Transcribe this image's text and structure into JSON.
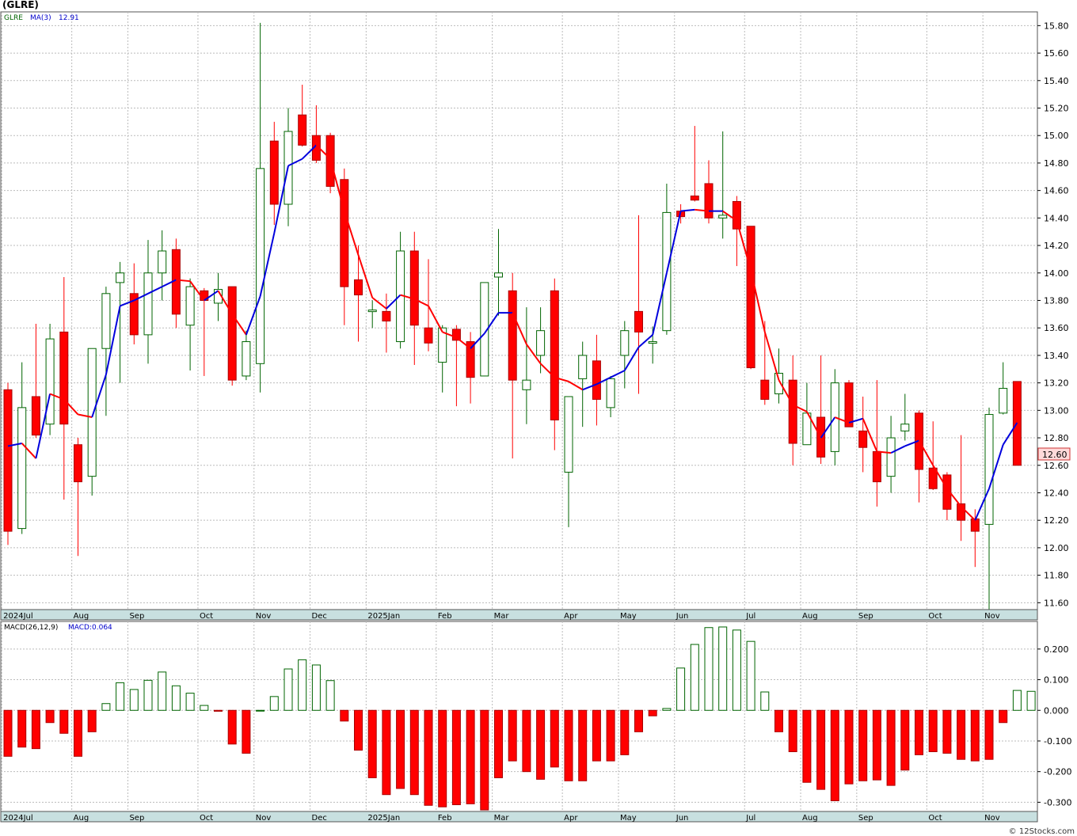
{
  "title": "(GLRE)",
  "credit": "© 12Stocks.com",
  "colors": {
    "up": "#006400",
    "down": "#ff0000",
    "ma_up": "#0000dd",
    "ma_down": "#ff0000",
    "axisbar": "#c8e0e0",
    "grid": "#bbbbbb",
    "last_tag_bg": "#ffd9d9"
  },
  "legend": {
    "symbol": "GLRE",
    "ma_label": "MA(3)",
    "ma_value": "12.91",
    "macd_label": "MACD(26,12,9)",
    "macd_value_label": "MACD:0.064"
  },
  "last_price_tag": "12.60",
  "chart_data": [
    {
      "type": "candlestick",
      "name": "GLRE weekly price",
      "ylim": [
        11.55,
        15.9
      ],
      "y_ticks": [
        "11.60",
        "11.80",
        "12.00",
        "12.20",
        "12.40",
        "12.60",
        "12.80",
        "13.00",
        "13.20",
        "13.40",
        "13.60",
        "13.80",
        "14.00",
        "14.20",
        "14.40",
        "14.60",
        "14.80",
        "15.00",
        "15.20",
        "15.40",
        "15.60",
        "15.80"
      ],
      "x_labels": [
        {
          "label": "2024Jul",
          "index": 0
        },
        {
          "label": "Aug",
          "index": 5
        },
        {
          "label": "Sep",
          "index": 9
        },
        {
          "label": "Oct",
          "index": 14
        },
        {
          "label": "Nov",
          "index": 18
        },
        {
          "label": "Dec",
          "index": 22
        },
        {
          "label": "2025Jan",
          "index": 26
        },
        {
          "label": "Feb",
          "index": 31
        },
        {
          "label": "Mar",
          "index": 35
        },
        {
          "label": "Apr",
          "index": 40
        },
        {
          "label": "May",
          "index": 44
        },
        {
          "label": "Jun",
          "index": 48
        },
        {
          "label": "Jul",
          "index": 53
        },
        {
          "label": "Aug",
          "index": 57
        },
        {
          "label": "Sep",
          "index": 61
        },
        {
          "label": "Oct",
          "index": 66
        },
        {
          "label": "Nov",
          "index": 70
        }
      ],
      "candles": [
        {
          "o": 13.15,
          "h": 13.2,
          "l": 12.02,
          "c": 12.12
        },
        {
          "o": 12.14,
          "h": 13.35,
          "l": 12.1,
          "c": 13.02
        },
        {
          "o": 13.1,
          "h": 13.63,
          "l": 12.8,
          "c": 12.82
        },
        {
          "o": 12.9,
          "h": 13.63,
          "l": 12.82,
          "c": 13.52
        },
        {
          "o": 13.57,
          "h": 13.97,
          "l": 12.35,
          "c": 12.9
        },
        {
          "o": 12.75,
          "h": 12.8,
          "l": 11.94,
          "c": 12.48
        },
        {
          "o": 12.52,
          "h": 13.45,
          "l": 12.38,
          "c": 13.45
        },
        {
          "o": 13.45,
          "h": 13.9,
          "l": 12.96,
          "c": 13.85
        },
        {
          "o": 13.93,
          "h": 14.08,
          "l": 13.2,
          "c": 14.0
        },
        {
          "o": 13.85,
          "h": 14.07,
          "l": 13.48,
          "c": 13.55
        },
        {
          "o": 13.55,
          "h": 14.24,
          "l": 13.34,
          "c": 14.0
        },
        {
          "o": 14.0,
          "h": 14.31,
          "l": 13.8,
          "c": 14.16
        },
        {
          "o": 14.17,
          "h": 14.25,
          "l": 13.6,
          "c": 13.7
        },
        {
          "o": 13.62,
          "h": 13.96,
          "l": 13.29,
          "c": 13.9
        },
        {
          "o": 13.87,
          "h": 13.89,
          "l": 13.25,
          "c": 13.8
        },
        {
          "o": 13.78,
          "h": 14.0,
          "l": 13.65,
          "c": 13.88
        },
        {
          "o": 13.9,
          "h": 13.9,
          "l": 13.18,
          "c": 13.22
        },
        {
          "o": 13.25,
          "h": 13.58,
          "l": 13.22,
          "c": 13.5
        },
        {
          "o": 13.34,
          "h": 15.82,
          "l": 13.13,
          "c": 14.76
        },
        {
          "o": 14.96,
          "h": 15.1,
          "l": 14.35,
          "c": 14.5
        },
        {
          "o": 14.5,
          "h": 15.2,
          "l": 14.34,
          "c": 15.03
        },
        {
          "o": 15.15,
          "h": 15.37,
          "l": 14.92,
          "c": 14.93
        },
        {
          "o": 15.0,
          "h": 15.22,
          "l": 14.8,
          "c": 14.82
        },
        {
          "o": 15.0,
          "h": 15.02,
          "l": 14.58,
          "c": 14.63
        },
        {
          "o": 14.68,
          "h": 14.76,
          "l": 13.62,
          "c": 13.9
        },
        {
          "o": 13.95,
          "h": 14.2,
          "l": 13.5,
          "c": 13.84
        },
        {
          "o": 13.73,
          "h": 13.8,
          "l": 13.6,
          "c": 13.73
        },
        {
          "o": 13.72,
          "h": 13.85,
          "l": 13.42,
          "c": 13.65
        },
        {
          "o": 13.5,
          "h": 14.3,
          "l": 13.45,
          "c": 14.16
        },
        {
          "o": 14.16,
          "h": 14.3,
          "l": 13.33,
          "c": 13.62
        },
        {
          "o": 13.6,
          "h": 14.1,
          "l": 13.43,
          "c": 13.49
        },
        {
          "o": 13.35,
          "h": 13.62,
          "l": 13.13,
          "c": 13.6
        },
        {
          "o": 13.59,
          "h": 13.62,
          "l": 13.03,
          "c": 13.51
        },
        {
          "o": 13.5,
          "h": 13.57,
          "l": 13.05,
          "c": 13.24
        },
        {
          "o": 13.25,
          "h": 13.93,
          "l": 13.25,
          "c": 13.93
        },
        {
          "o": 13.97,
          "h": 14.32,
          "l": 13.69,
          "c": 14.0
        },
        {
          "o": 13.87,
          "h": 14.0,
          "l": 12.65,
          "c": 13.22
        },
        {
          "o": 13.15,
          "h": 13.75,
          "l": 12.9,
          "c": 13.22
        },
        {
          "o": 13.4,
          "h": 13.75,
          "l": 13.27,
          "c": 13.58
        },
        {
          "o": 13.87,
          "h": 13.96,
          "l": 12.71,
          "c": 12.93
        },
        {
          "o": 12.55,
          "h": 13.1,
          "l": 12.15,
          "c": 13.1
        },
        {
          "o": 13.23,
          "h": 13.5,
          "l": 12.88,
          "c": 13.4
        },
        {
          "o": 13.36,
          "h": 13.55,
          "l": 12.89,
          "c": 13.08
        },
        {
          "o": 13.02,
          "h": 13.25,
          "l": 12.95,
          "c": 13.23
        },
        {
          "o": 13.4,
          "h": 13.65,
          "l": 13.16,
          "c": 13.58
        },
        {
          "o": 13.72,
          "h": 14.42,
          "l": 13.12,
          "c": 13.57
        },
        {
          "o": 13.5,
          "h": 13.61,
          "l": 13.34,
          "c": 13.5
        },
        {
          "o": 13.58,
          "h": 14.65,
          "l": 13.55,
          "c": 14.44
        },
        {
          "o": 14.45,
          "h": 14.5,
          "l": 14.36,
          "c": 14.41
        },
        {
          "o": 14.56,
          "h": 15.07,
          "l": 14.52,
          "c": 14.53
        },
        {
          "o": 14.65,
          "h": 14.82,
          "l": 14.36,
          "c": 14.4
        },
        {
          "o": 14.4,
          "h": 15.03,
          "l": 14.25,
          "c": 14.42
        },
        {
          "o": 14.52,
          "h": 14.56,
          "l": 14.05,
          "c": 14.32
        },
        {
          "o": 14.34,
          "h": 14.34,
          "l": 13.3,
          "c": 13.31
        },
        {
          "o": 13.22,
          "h": 13.65,
          "l": 13.04,
          "c": 13.08
        },
        {
          "o": 13.12,
          "h": 13.45,
          "l": 13.05,
          "c": 13.27
        },
        {
          "o": 13.22,
          "h": 13.4,
          "l": 12.6,
          "c": 12.76
        },
        {
          "o": 12.75,
          "h": 13.2,
          "l": 12.75,
          "c": 12.98
        },
        {
          "o": 12.95,
          "h": 13.4,
          "l": 12.61,
          "c": 12.66
        },
        {
          "o": 12.7,
          "h": 13.3,
          "l": 12.6,
          "c": 13.2
        },
        {
          "o": 13.2,
          "h": 13.22,
          "l": 12.88,
          "c": 12.88
        },
        {
          "o": 12.85,
          "h": 13.1,
          "l": 12.55,
          "c": 12.73
        },
        {
          "o": 12.7,
          "h": 13.22,
          "l": 12.3,
          "c": 12.48
        },
        {
          "o": 12.52,
          "h": 12.96,
          "l": 12.4,
          "c": 12.8
        },
        {
          "o": 12.85,
          "h": 13.12,
          "l": 12.78,
          "c": 12.9
        },
        {
          "o": 12.98,
          "h": 13.0,
          "l": 12.33,
          "c": 12.57
        },
        {
          "o": 12.58,
          "h": 12.92,
          "l": 12.42,
          "c": 12.43
        },
        {
          "o": 12.53,
          "h": 12.55,
          "l": 12.2,
          "c": 12.28
        },
        {
          "o": 12.32,
          "h": 12.82,
          "l": 12.05,
          "c": 12.2
        },
        {
          "o": 12.21,
          "h": 12.28,
          "l": 11.86,
          "c": 12.12
        },
        {
          "o": 12.17,
          "h": 13.02,
          "l": 11.54,
          "c": 12.97
        },
        {
          "o": 12.98,
          "h": 13.35,
          "l": 12.97,
          "c": 13.16
        },
        {
          "o": 13.21,
          "h": 13.21,
          "l": 12.6,
          "c": 12.6
        }
      ],
      "ma3": [
        12.74,
        12.76,
        12.65,
        13.12,
        13.08,
        12.97,
        12.95,
        13.26,
        13.76,
        13.8,
        13.85,
        13.9,
        13.95,
        13.94,
        13.8,
        13.87,
        13.7,
        13.55,
        13.83,
        14.29,
        14.78,
        14.83,
        14.93,
        14.83,
        14.45,
        14.13,
        13.82,
        13.74,
        13.84,
        13.81,
        13.76,
        13.57,
        13.53,
        13.45,
        13.56,
        13.71,
        13.71,
        13.48,
        13.34,
        13.24,
        13.21,
        13.15,
        13.19,
        13.24,
        13.29,
        13.46,
        13.55,
        14.0,
        14.45,
        14.46,
        14.45,
        14.45,
        14.38,
        14.02,
        13.57,
        13.22,
        13.04,
        12.99,
        12.8,
        12.95,
        12.91,
        12.94,
        12.7,
        12.69,
        12.74,
        12.78,
        12.6,
        12.43,
        12.3,
        12.2,
        12.43,
        12.75,
        12.91
      ]
    },
    {
      "type": "bar",
      "name": "MACD(26,12,9)",
      "ylim": [
        -0.33,
        0.29
      ],
      "y_ticks": [
        "0.200",
        "0.100",
        "0.000",
        "-0.100",
        "-0.200",
        "-0.300"
      ],
      "values": [
        -0.15,
        -0.12,
        -0.125,
        -0.04,
        -0.075,
        -0.15,
        -0.07,
        0.022,
        0.09,
        0.068,
        0.098,
        0.125,
        0.08,
        0.056,
        0.016,
        -0.003,
        -0.11,
        -0.14,
        0.0,
        0.045,
        0.135,
        0.165,
        0.148,
        0.097,
        -0.035,
        -0.13,
        -0.22,
        -0.275,
        -0.255,
        -0.275,
        -0.31,
        -0.315,
        -0.308,
        -0.305,
        -0.325,
        -0.22,
        -0.165,
        -0.2,
        -0.225,
        -0.185,
        -0.23,
        -0.23,
        -0.165,
        -0.165,
        -0.145,
        -0.07,
        -0.018,
        0.006,
        0.138,
        0.215,
        0.27,
        0.272,
        0.262,
        0.225,
        0.06,
        -0.07,
        -0.135,
        -0.235,
        -0.258,
        -0.295,
        -0.24,
        -0.23,
        -0.227,
        -0.245,
        -0.195,
        -0.145,
        -0.135,
        -0.14,
        -0.16,
        -0.165,
        -0.16,
        -0.04,
        0.065,
        0.062
      ]
    }
  ]
}
